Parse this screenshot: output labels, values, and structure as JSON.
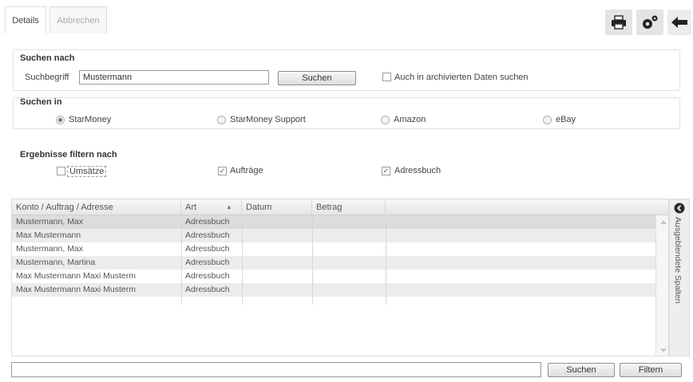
{
  "tabs": [
    {
      "label": "Details",
      "active": true
    },
    {
      "label": "Abbrechen",
      "active": false
    }
  ],
  "toolbar": {
    "print_icon": "printer-icon",
    "settings_icon": "gears-icon",
    "back_icon": "arrow-left-icon"
  },
  "search": {
    "group_title": "Suchen nach",
    "term_label": "Suchbegriff",
    "term_value": "Mustermann",
    "search_button": "Suchen",
    "archive_checkbox_label": "Auch in archivierten Daten suchen",
    "archive_checked": false
  },
  "search_in": {
    "group_title": "Suchen in",
    "options": [
      {
        "label": "StarMoney",
        "checked": true
      },
      {
        "label": "StarMoney Support",
        "checked": false
      },
      {
        "label": "Amazon",
        "checked": false
      },
      {
        "label": "eBay",
        "checked": false
      }
    ]
  },
  "filter": {
    "group_title": "Ergebnisse filtern nach",
    "options": [
      {
        "label": "Umsätze",
        "checked": false
      },
      {
        "label": "Aufträge",
        "checked": true
      },
      {
        "label": "Adressbuch",
        "checked": true
      }
    ]
  },
  "table": {
    "columns": [
      "Konto / Auftrag / Adresse",
      "Art",
      "Datum",
      "Betrag"
    ],
    "sort_indicator": "▲",
    "rows": [
      [
        "Mustermann, Max",
        "Adressbuch",
        "",
        ""
      ],
      [
        "Max Mustermann",
        "Adressbuch",
        "",
        ""
      ],
      [
        "Mustermann, Max",
        "Adressbuch",
        "",
        ""
      ],
      [
        "Mustermann, Martina",
        "Adressbuch",
        "",
        ""
      ],
      [
        "Max Mustermann Maxi Musterm",
        "Adressbuch",
        "",
        ""
      ],
      [
        "Max Mustermann Maxi Musterm",
        "Adressbuch",
        "",
        ""
      ]
    ]
  },
  "side_panel": {
    "label": "Ausgeblendete Spalten",
    "icon": "chevron-left-circle-icon"
  },
  "bottom": {
    "filter_input_value": "",
    "search_button": "Suchen",
    "filter_button": "Filtern"
  }
}
